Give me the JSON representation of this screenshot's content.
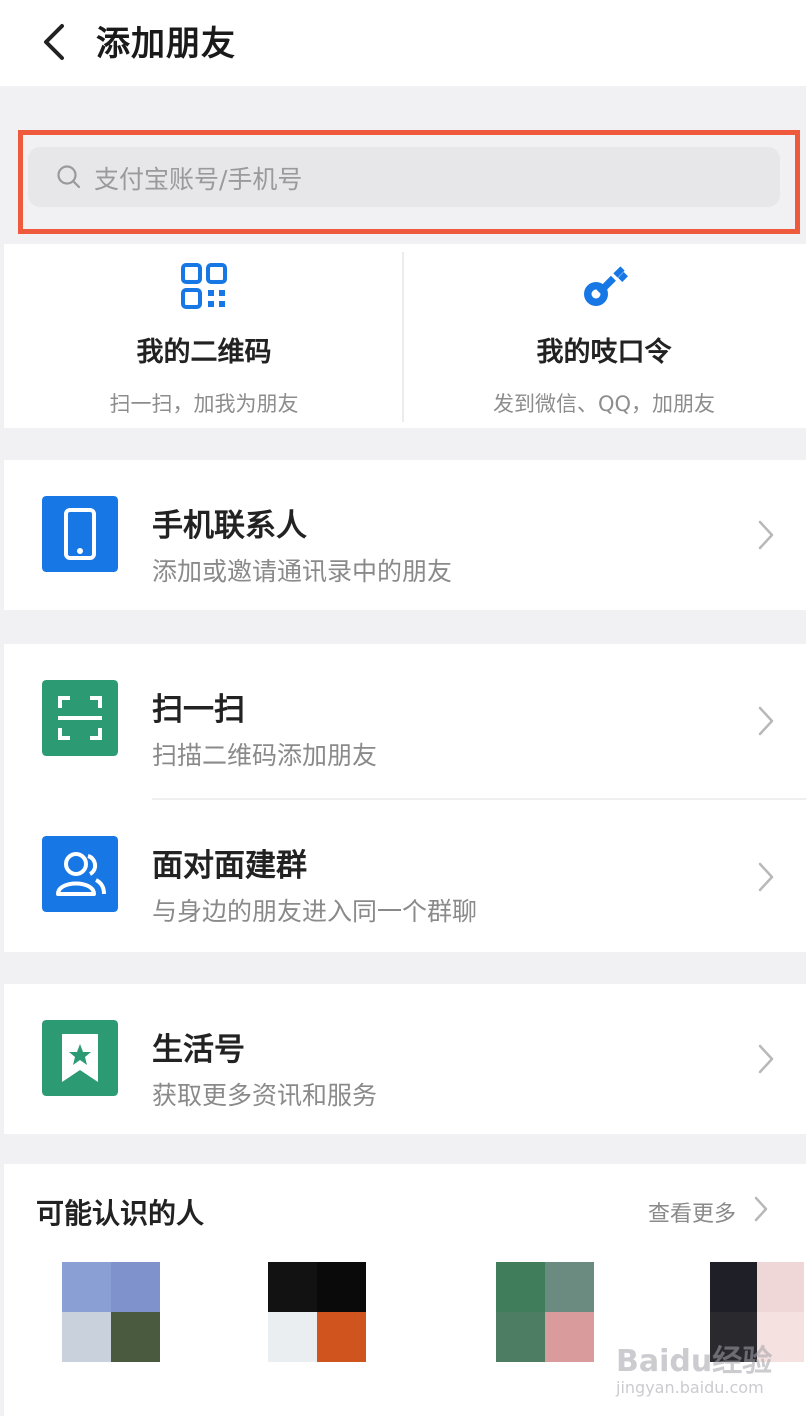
{
  "header": {
    "title": "添加朋友"
  },
  "search": {
    "placeholder": "支付宝账号/手机号"
  },
  "quick_actions": [
    {
      "icon": "qr-code-icon",
      "title": "我的二维码",
      "subtitle": "扫一扫，加我为朋友"
    },
    {
      "icon": "key-icon",
      "title": "我的吱口令",
      "subtitle": "发到微信、QQ，加朋友"
    }
  ],
  "menu": [
    {
      "icon": "phone-icon",
      "title": "手机联系人",
      "subtitle": "添加或邀请通讯录中的朋友"
    },
    {
      "icon": "scan-icon",
      "title": "扫一扫",
      "subtitle": "扫描二维码添加朋友"
    },
    {
      "icon": "group-icon",
      "title": "面对面建群",
      "subtitle": "与身边的朋友进入同一个群聊"
    },
    {
      "icon": "bookmark-star-icon",
      "title": "生活号",
      "subtitle": "获取更多资讯和服务"
    }
  ],
  "people": {
    "title": "可能认识的人",
    "more": "查看更多"
  },
  "watermark": {
    "text": "Baidu经验",
    "sub": "jingyan.baidu.com"
  },
  "colors": {
    "highlight_border": "#ef5a3c",
    "blue_icon": "#1677e5",
    "green_icon": "#2c9b74",
    "page_background": "#f1f1f3"
  }
}
